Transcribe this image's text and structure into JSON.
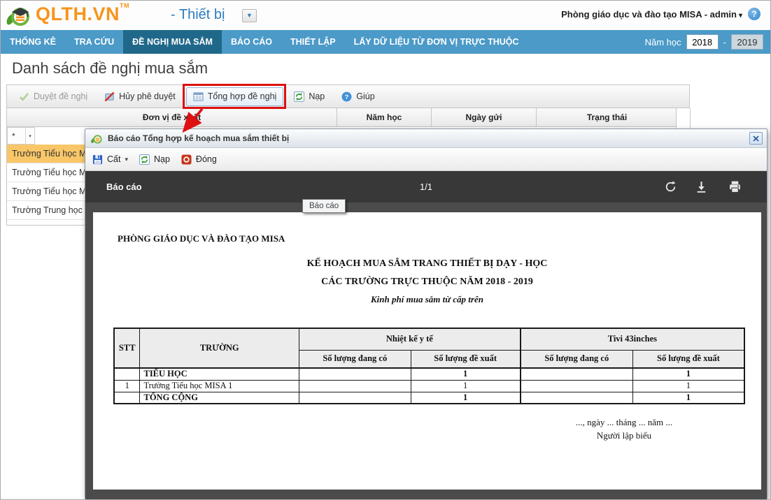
{
  "icons": {
    "caret_down": "▼",
    "caret_small": "▾"
  },
  "header": {
    "brand": "QLTH.VN",
    "brand_tm": "TM",
    "module": "- Thiết bị",
    "user": "Phòng giáo dục và đào tạo MISA - admin",
    "help": "?"
  },
  "nav": {
    "items": [
      {
        "label": "THỐNG KÊ",
        "active": false
      },
      {
        "label": "TRA CỨU",
        "active": false
      },
      {
        "label": "ĐỀ NGHỊ MUA SẮM",
        "active": true
      },
      {
        "label": "BÁO CÁO",
        "active": false
      },
      {
        "label": "THIẾT LẬP",
        "active": false
      },
      {
        "label": "LẤY DỮ LIỆU TỪ ĐƠN VỊ TRỰC THUỘC",
        "active": false
      }
    ],
    "year_label": "Năm học",
    "year_from": "2018",
    "year_separator": "-",
    "year_to": "2019"
  },
  "page": {
    "title": "Danh sách đề nghị mua sắm"
  },
  "toolbar": {
    "approve_label": "Duyệt đề nghị",
    "unapprove_label": "Hủy phê duyệt",
    "aggregate_label": "Tổng hợp đề nghị",
    "reload_label": "Nạp",
    "help_label": "Giúp"
  },
  "grid": {
    "columns": [
      {
        "label": "Đơn vị đề xuất"
      },
      {
        "label": "Năm học"
      },
      {
        "label": "Ngày gửi"
      },
      {
        "label": "Trạng thái"
      }
    ],
    "filter_marker": "*",
    "rows": [
      {
        "name": "Trường Tiểu học M",
        "selected": true
      },
      {
        "name": "Trường Tiểu học M",
        "selected": false
      },
      {
        "name": "Trường Tiểu học M",
        "selected": false
      },
      {
        "name": "Trường Trung học p",
        "selected": false
      }
    ]
  },
  "dialog": {
    "title": "Báo cáo Tổng hợp kế hoạch mua sắm thiết bị",
    "toolbar": {
      "save_label": "Cất",
      "reload_label": "Nạp",
      "close_label": "Đóng"
    },
    "viewer": {
      "left_label": "Báo cáo",
      "page_indicator": "1/1",
      "tooltip": "Báo cáo"
    },
    "report": {
      "org": "PHÒNG GIÁO DỤC VÀ ĐÀO TẠO MISA",
      "title_line1": "KẾ HOẠCH MUA SẮM TRANG THIẾT BỊ DẠY - HỌC",
      "title_line2": "CÁC TRƯỜNG TRỰC THUỘC NĂM 2018 - 2019",
      "subtitle": "Kinh phí mua sắm từ cấp trên",
      "table": {
        "col_stt": "STT",
        "col_school": "TRƯỜNG",
        "groups": [
          {
            "name": "Nhiệt kế y tế"
          },
          {
            "name": "Tivi 43inches"
          }
        ],
        "subheaders": [
          "Số lượng đang có",
          "Số lượng đề xuất"
        ],
        "rows": [
          {
            "stt": "",
            "school": "TIỂU HỌC",
            "values": [
              "",
              "1",
              "",
              "1"
            ]
          },
          {
            "stt": "1",
            "school": "Trường Tiểu học MISA 1",
            "values": [
              "",
              "1",
              "",
              "1"
            ]
          },
          {
            "stt": "",
            "school": "TỔNG CỘNG",
            "values": [
              "",
              "1",
              "",
              "1"
            ]
          }
        ]
      },
      "footer_line1": "..., ngày ... tháng ... năm ...",
      "footer_line2": "Người lập biểu"
    }
  },
  "colors": {
    "nav_bg": "#4b9ac8",
    "nav_active_bg": "#20688a",
    "brand_orange": "#f7941d",
    "logo_green": "#6db33f",
    "selected_row_bg": "#f9c768",
    "annotation_red": "#dd1111",
    "viewer_bar_bg": "#383838",
    "viewer_bg": "#4b4b4b"
  }
}
